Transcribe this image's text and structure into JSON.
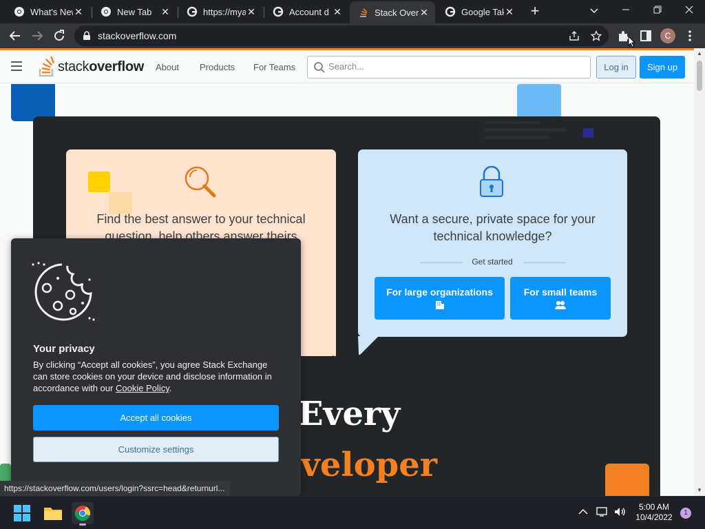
{
  "browser": {
    "tabs": [
      {
        "title": "What's New",
        "icon": "chrome-icon"
      },
      {
        "title": "New Tab",
        "icon": "chrome-icon"
      },
      {
        "title": "https://mya",
        "icon": "google-icon"
      },
      {
        "title": "Account d",
        "icon": "google-icon"
      },
      {
        "title": "Stack Overf",
        "icon": "stackoverflow-icon",
        "active": true
      },
      {
        "title": "Google Tak",
        "icon": "google-icon"
      }
    ],
    "url": "stackoverflow.com",
    "profile_initial": "C",
    "status_url": "https://stackoverflow.com/users/login?ssrc=head&returnurl..."
  },
  "site": {
    "logo": {
      "light": "stack",
      "bold": "overflow"
    },
    "nav": {
      "about": "About",
      "products": "Products",
      "for_teams": "For Teams"
    },
    "search_placeholder": "Search...",
    "login": "Log in",
    "signup": "Sign up"
  },
  "hero": {
    "orange_card_text": "Find the best answer to your technical question, help others answer theirs",
    "blue_card_text": "Want a secure, private space for your technical knowledge?",
    "get_started": "Get started",
    "large_orgs_btn": "For large organizations",
    "small_teams_btn": "For small teams",
    "headline_1": "Every",
    "headline_2": "veloper"
  },
  "cookie": {
    "title": "Your privacy",
    "body": "By clicking “Accept all cookies”, you agree Stack Exchange can store cookies on your device and disclose information in accordance with our",
    "link": "Cookie Policy",
    "accept": "Accept all cookies",
    "customize": "Customize settings"
  },
  "taskbar": {
    "time": "5:00 AM",
    "date": "10/4/2022",
    "notifications": "1"
  },
  "colors": {
    "so_orange": "#f48024",
    "so_blue": "#0a95ff",
    "hero_dark": "#232629"
  }
}
